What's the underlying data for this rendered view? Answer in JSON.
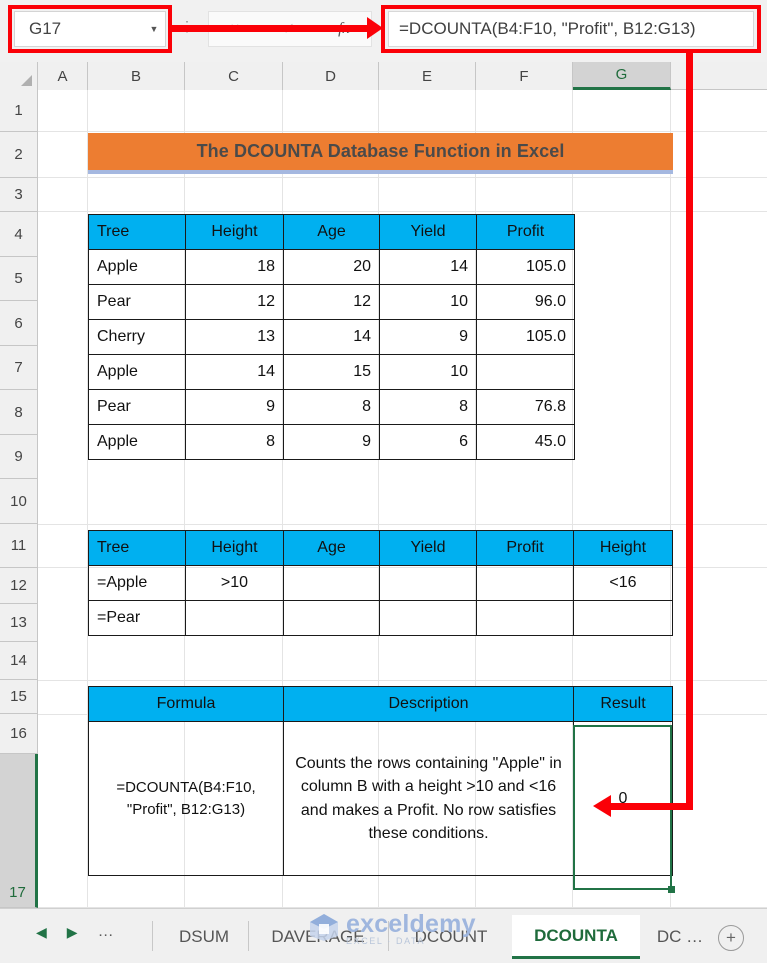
{
  "app": {
    "name_box_value": "G17",
    "formula_bar_value": "=DCOUNTA(B4:F10, \"Profit\", B12:G13)",
    "cancel_icon": "×",
    "confirm_icon": "✓",
    "function_icon": "fx",
    "name_box_caret_icon": "▼",
    "fbar_dots_icon": "⋮",
    "corner_select_all_icon": "select-all-triangle"
  },
  "colors": {
    "header_blue": "#00B0F0",
    "title_orange": "#ED7D31",
    "selection_green": "#217346",
    "annotation_red": "#FB0007",
    "title_underline": "#A5B8E0"
  },
  "grid": {
    "column_headers": [
      "A",
      "B",
      "C",
      "D",
      "E",
      "F",
      "G"
    ],
    "selected_column": "G",
    "row_headers": [
      "1",
      "2",
      "3",
      "4",
      "5",
      "6",
      "7",
      "8",
      "9",
      "10",
      "11",
      "12",
      "13",
      "14",
      "15",
      "16",
      "17"
    ],
    "selected_row": "17"
  },
  "title": {
    "text": "The DCOUNTA Database Function in Excel"
  },
  "database_table": {
    "headers": [
      "Tree",
      "Height",
      "Age",
      "Yield",
      "Profit"
    ],
    "rows": [
      {
        "tree": "Apple",
        "height": "18",
        "age": "20",
        "yield": "14",
        "profit": "105.0"
      },
      {
        "tree": "Pear",
        "height": "12",
        "age": "12",
        "yield": "10",
        "profit": "96.0"
      },
      {
        "tree": "Cherry",
        "height": "13",
        "age": "14",
        "yield": "9",
        "profit": "105.0"
      },
      {
        "tree": "Apple",
        "height": "14",
        "age": "15",
        "yield": "10",
        "profit": ""
      },
      {
        "tree": "Pear",
        "height": "9",
        "age": "8",
        "yield": "8",
        "profit": "76.8"
      },
      {
        "tree": "Apple",
        "height": "8",
        "age": "9",
        "yield": "6",
        "profit": "45.0"
      }
    ]
  },
  "criteria_table": {
    "headers": [
      "Tree",
      "Height",
      "Age",
      "Yield",
      "Profit",
      "Height"
    ],
    "rows": [
      {
        "tree": "=Apple",
        "height": ">10",
        "age": "",
        "yield": "",
        "profit": "",
        "height2": "<16"
      },
      {
        "tree": "=Pear",
        "height": "",
        "age": "",
        "yield": "",
        "profit": "",
        "height2": ""
      }
    ]
  },
  "result_table": {
    "headers": [
      "Formula",
      "Description",
      "Result"
    ],
    "row": {
      "formula": "=DCOUNTA(B4:F10, \"Profit\", B12:G13)",
      "description": "Counts the rows containing \"Apple\" in column B with a height >10 and <16 and makes a Profit. No row satisfies these conditions.",
      "result": "0"
    }
  },
  "sheet_tabs": {
    "nav_first_icon": "◀",
    "nav_next_icon": "▶",
    "nav_dots": "…",
    "tabs": [
      {
        "label": "DSUM",
        "active": false
      },
      {
        "label": "DAVERAGE",
        "active": false
      },
      {
        "label": "DCOUNT",
        "active": false
      },
      {
        "label": "DCOUNTA",
        "active": true
      },
      {
        "label": "DC  …",
        "active": false
      }
    ],
    "add_sheet_icon": "+"
  },
  "watermark": {
    "brand": "exceldemy",
    "tagline": "EXCEL · DATA"
  }
}
